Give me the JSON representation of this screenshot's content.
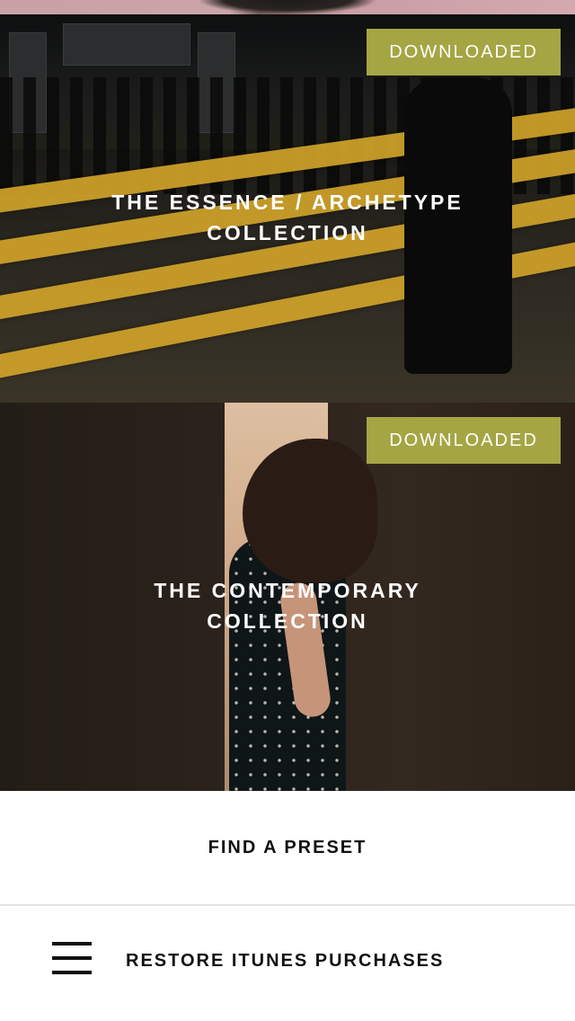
{
  "collections": [
    {
      "title_line1": "THE ESSENCE / ARCHETYPE",
      "title_line2": "COLLECTION",
      "badge": "DOWNLOADED"
    },
    {
      "title_line1": "THE CONTEMPORARY",
      "title_line2": "COLLECTION",
      "badge": "DOWNLOADED"
    }
  ],
  "find_preset_label": "FIND A PRESET",
  "bottom_bar": {
    "menu_icon": "hamburger-menu-icon",
    "restore_label": "RESTORE ITUNES PURCHASES"
  },
  "colors": {
    "badge_bg": "#a5a544",
    "text_dark": "#111111"
  }
}
